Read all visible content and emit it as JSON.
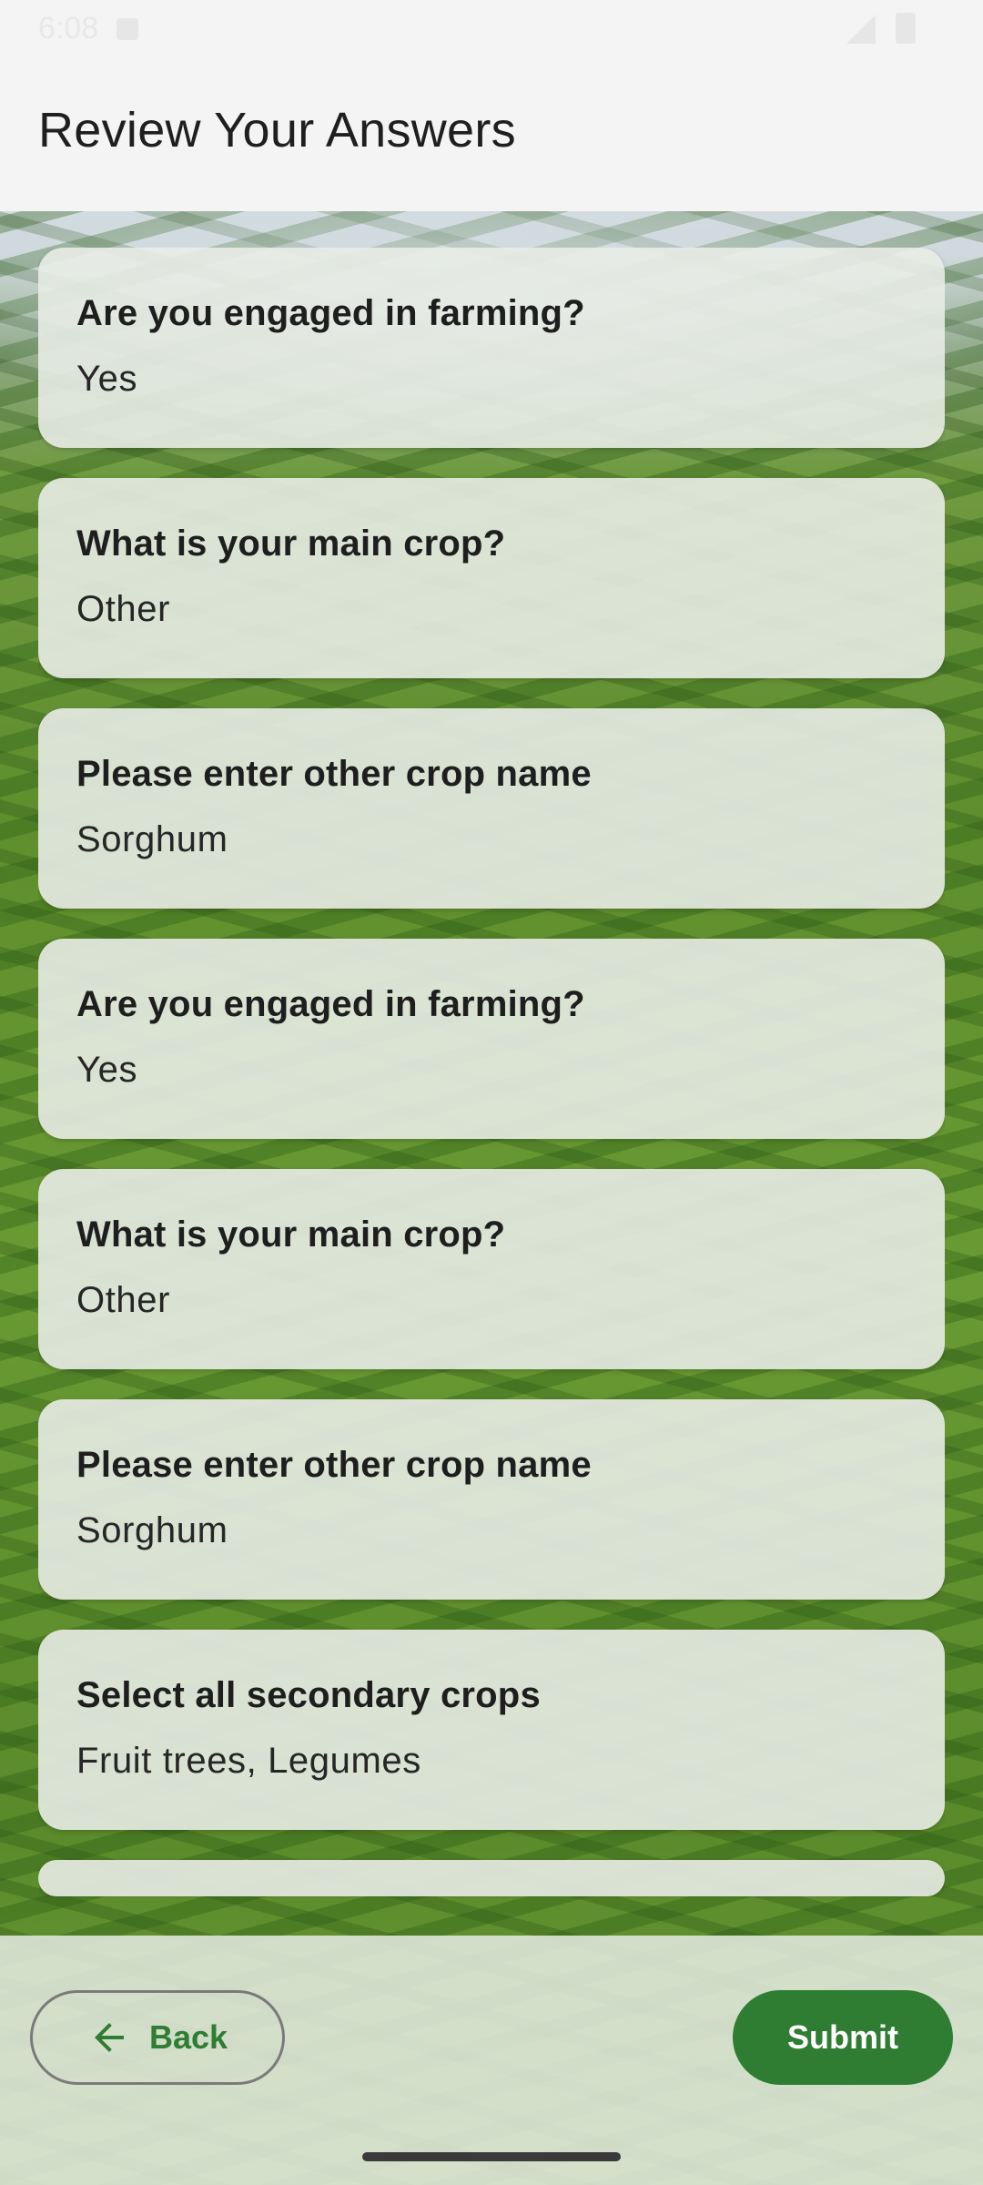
{
  "status_bar": {
    "time": "6:08"
  },
  "header": {
    "title": "Review Your Answers"
  },
  "answers": [
    {
      "question": "Are you engaged in farming?",
      "answer": "Yes"
    },
    {
      "question": "What is your main crop?",
      "answer": "Other"
    },
    {
      "question": "Please enter other crop name",
      "answer": "Sorghum"
    },
    {
      "question": "Are you engaged in farming?",
      "answer": "Yes"
    },
    {
      "question": "What is your main crop?",
      "answer": "Other"
    },
    {
      "question": "Please enter other crop name",
      "answer": "Sorghum"
    },
    {
      "question": "Select all secondary crops",
      "answer": "Fruit trees, Legumes"
    }
  ],
  "actions": {
    "back_label": "Back",
    "submit_label": "Submit"
  },
  "colors": {
    "primary": "#2e7d32",
    "card_background": "#e8ece6",
    "title_text": "#1f1f1f"
  },
  "icons": {
    "back": "arrow-left-icon",
    "signal": "signal-icon",
    "battery": "battery-icon"
  }
}
